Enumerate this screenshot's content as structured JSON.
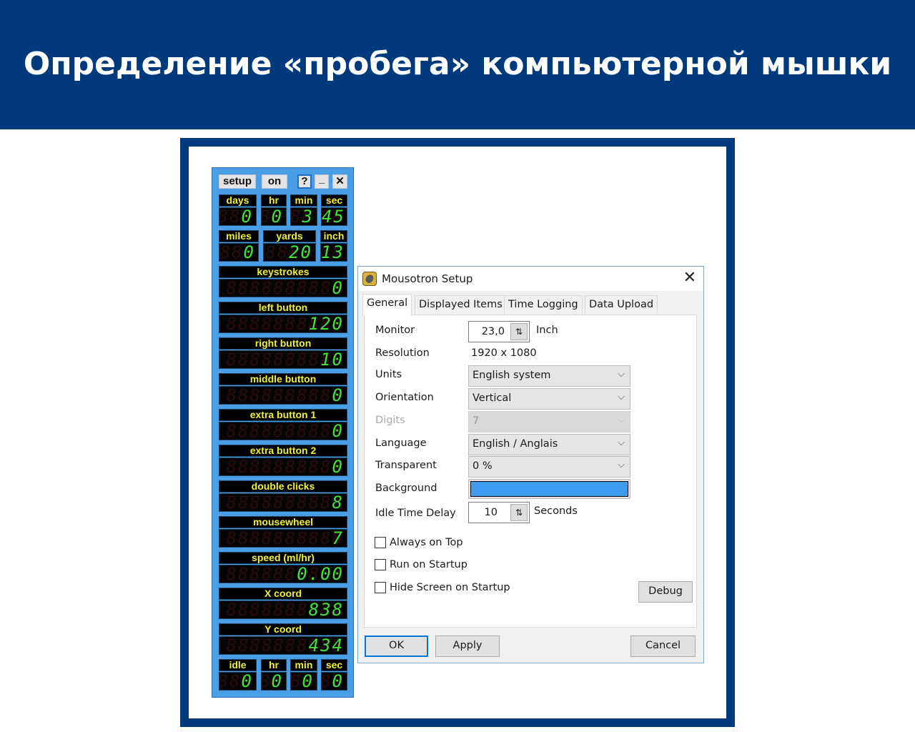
{
  "banner": {
    "title": "Определение «пробега» компьютерной мышки",
    "background": "#003a7d"
  },
  "counter_panel": {
    "background": "#4a9ee6",
    "controls": {
      "setup_label": "setup",
      "on_label": "on",
      "help_label": "?",
      "minimize_label": "_",
      "close_label": "✕"
    },
    "uptime": {
      "labels": [
        "days",
        "hr",
        "min",
        "sec"
      ],
      "values": [
        "0",
        "0",
        "3",
        "45"
      ]
    },
    "distance": {
      "labels": [
        "miles",
        "yards",
        "inch"
      ],
      "values": [
        "0",
        "20",
        "13"
      ]
    },
    "counters": [
      {
        "label": "keystrokes",
        "value": "0"
      },
      {
        "label": "left button",
        "value": "120"
      },
      {
        "label": "right button",
        "value": "10"
      },
      {
        "label": "middle button",
        "value": "0"
      },
      {
        "label": "extra button 1",
        "value": "0"
      },
      {
        "label": "extra button 2",
        "value": "0"
      },
      {
        "label": "double clicks",
        "value": "8"
      },
      {
        "label": "mousewheel",
        "value": "7"
      },
      {
        "label": "speed (ml/hr)",
        "value": "0.00"
      },
      {
        "label": "X coord",
        "value": "838"
      },
      {
        "label": "Y coord",
        "value": "434"
      }
    ],
    "idle": {
      "labels": [
        "idle",
        "hr",
        "min",
        "sec"
      ],
      "values": [
        "0",
        "0",
        "0",
        "0"
      ]
    },
    "digit_color": "#41e23c",
    "label_color": "#f2ef3a"
  },
  "setup_dialog": {
    "title": "Mousotron Setup",
    "close_label": "✕",
    "tabs": [
      {
        "label": "General",
        "active": true
      },
      {
        "label": "Displayed Items",
        "active": false
      },
      {
        "label": "Time Logging",
        "active": false
      },
      {
        "label": "Data Upload",
        "active": false
      }
    ],
    "fields": {
      "monitor": {
        "label": "Monitor",
        "value": "23,0",
        "unit": "Inch"
      },
      "resolution": {
        "label": "Resolution",
        "value": "1920 x 1080"
      },
      "units": {
        "label": "Units",
        "value": "English system"
      },
      "orientation": {
        "label": "Orientation",
        "value": "Vertical"
      },
      "digits": {
        "label": "Digits",
        "value": "7",
        "disabled": true
      },
      "language": {
        "label": "Language",
        "value": "English / Anglais"
      },
      "transparent": {
        "label": "Transparent",
        "value": "0 %"
      },
      "background": {
        "label": "Background",
        "color": "#3d9bf0"
      },
      "idle_time_delay": {
        "label": "Idle Time Delay",
        "value": "10",
        "unit": "Seconds"
      }
    },
    "checkboxes": [
      {
        "label": "Always on Top",
        "checked": false
      },
      {
        "label": "Run on Startup",
        "checked": false
      },
      {
        "label": "Hide Screen on Startup",
        "checked": false
      }
    ],
    "buttons": {
      "debug": "Debug",
      "ok": "OK",
      "apply": "Apply",
      "cancel": "Cancel"
    },
    "spin_arrows": "⇅",
    "chevron": "⌵"
  }
}
